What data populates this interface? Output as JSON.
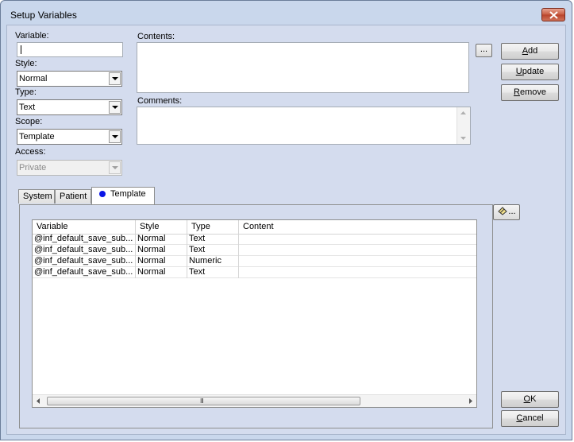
{
  "window": {
    "title": "Setup Variables"
  },
  "form": {
    "variable_label": "Variable:",
    "variable_value": "",
    "style_label": "Style:",
    "style_value": "Normal",
    "type_label": "Type:",
    "type_value": "Text",
    "scope_label": "Scope:",
    "scope_value": "Template",
    "access_label": "Access:",
    "access_value": "Private",
    "contents_label": "Contents:",
    "contents_value": "",
    "comments_label": "Comments:",
    "comments_value": "",
    "browse_label": "..."
  },
  "buttons": {
    "add": {
      "mnemonic": "A",
      "rest": "dd"
    },
    "update": {
      "mnemonic": "U",
      "rest": "pdate"
    },
    "remove": {
      "mnemonic": "R",
      "rest": "emove"
    },
    "ok": {
      "mnemonic": "O",
      "rest": "K"
    },
    "cancel": {
      "mnemonic": "C",
      "rest": "ancel"
    },
    "edit_ellipsis": "..."
  },
  "tabs": [
    {
      "label": "System"
    },
    {
      "label": "Patient"
    },
    {
      "label": "Template",
      "active": true,
      "dot_color": "#0a14e6"
    }
  ],
  "table": {
    "columns": [
      "Variable",
      "Style",
      "Type",
      "Content"
    ],
    "rows": [
      {
        "variable": "@inf_default_save_sub...",
        "style": "Normal",
        "type": "Text",
        "content": ""
      },
      {
        "variable": "@inf_default_save_sub...",
        "style": "Normal",
        "type": "Text",
        "content": ""
      },
      {
        "variable": "@inf_default_save_sub...",
        "style": "Normal",
        "type": "Numeric",
        "content": ""
      },
      {
        "variable": "@inf_default_save_sub...",
        "style": "Normal",
        "type": "Text",
        "content": ""
      }
    ],
    "scroll_grip": "III"
  },
  "colors": {
    "window_bg": "#c9d7ec",
    "client_bg": "#d4dcee",
    "close_button": "#c75a3e",
    "active_tab_dot": "#0a14e6"
  },
  "icons": {
    "close": "close-icon",
    "dropdown": "chevron-down-icon",
    "edit": "eraser-icon"
  }
}
